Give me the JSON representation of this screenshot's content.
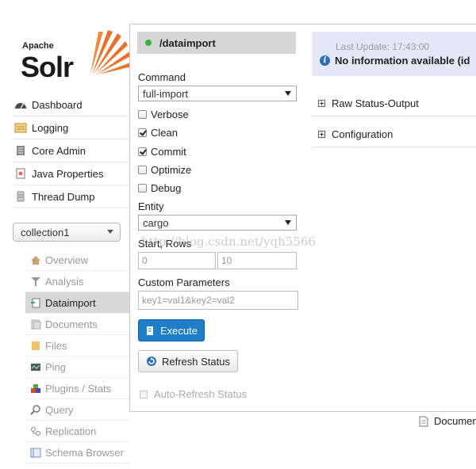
{
  "logo": {
    "brand": "Apache",
    "product": "Solr"
  },
  "main_nav": [
    {
      "label": "Dashboard",
      "icon": "dashboard-icon"
    },
    {
      "label": "Logging",
      "icon": "logging-icon"
    },
    {
      "label": "Core Admin",
      "icon": "core-admin-icon"
    },
    {
      "label": "Java Properties",
      "icon": "java-icon"
    },
    {
      "label": "Thread Dump",
      "icon": "thread-dump-icon"
    }
  ],
  "core_selector": {
    "value": "collection1"
  },
  "core_nav": [
    {
      "label": "Overview",
      "icon": "overview-icon"
    },
    {
      "label": "Analysis",
      "icon": "analysis-icon"
    },
    {
      "label": "Dataimport",
      "icon": "dataimport-icon"
    },
    {
      "label": "Documents",
      "icon": "documents-icon"
    },
    {
      "label": "Files",
      "icon": "files-icon"
    },
    {
      "label": "Ping",
      "icon": "ping-icon"
    },
    {
      "label": "Plugins / Stats",
      "icon": "plugins-icon"
    },
    {
      "label": "Query",
      "icon": "query-icon"
    },
    {
      "label": "Replication",
      "icon": "replication-icon"
    },
    {
      "label": "Schema Browser",
      "icon": "schema-icon"
    }
  ],
  "dataimport": {
    "handler": "/dataimport",
    "command_label": "Command",
    "command_value": "full-import",
    "options": {
      "verbose": "Verbose",
      "clean": "Clean",
      "commit": "Commit",
      "optimize": "Optimize",
      "debug": "Debug"
    },
    "entity_label": "Entity",
    "entity_value": "cargo",
    "start_rows_label": "Start, Rows",
    "start_placeholder": "0",
    "rows_placeholder": "10",
    "custom_params_label": "Custom Parameters",
    "custom_params_placeholder": "key1=val1&key2=val2",
    "execute_label": "Execute",
    "refresh_label": "Refresh Status",
    "auto_refresh_label": "Auto-Refresh Status"
  },
  "status": {
    "last_update": "Last Update: 17:43:00",
    "message": "No information available (id"
  },
  "sections": {
    "raw_status": "Raw Status-Output",
    "configuration": "Configuration"
  },
  "footer": {
    "documentation": "Documen"
  },
  "watermark": "http://blog.csdn.net/yqh5566",
  "colors": {
    "primary_button": "#1f7ec8",
    "status_bg": "#e3e8f6",
    "active_nav": "#d8d8d8",
    "status_dot": "#3bb43b"
  }
}
